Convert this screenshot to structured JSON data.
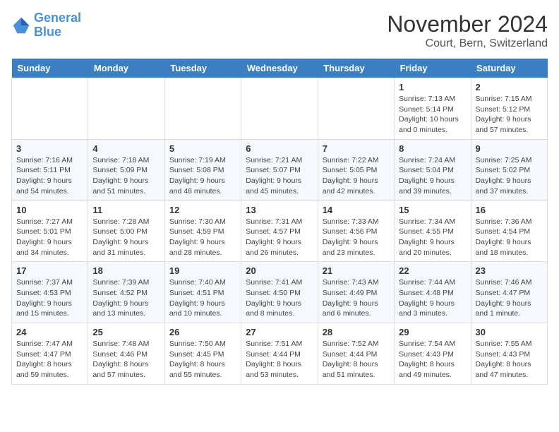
{
  "logo": {
    "line1": "General",
    "line2": "Blue"
  },
  "title": "November 2024",
  "location": "Court, Bern, Switzerland",
  "days_of_week": [
    "Sunday",
    "Monday",
    "Tuesday",
    "Wednesday",
    "Thursday",
    "Friday",
    "Saturday"
  ],
  "weeks": [
    [
      {
        "day": "",
        "info": ""
      },
      {
        "day": "",
        "info": ""
      },
      {
        "day": "",
        "info": ""
      },
      {
        "day": "",
        "info": ""
      },
      {
        "day": "",
        "info": ""
      },
      {
        "day": "1",
        "info": "Sunrise: 7:13 AM\nSunset: 5:14 PM\nDaylight: 10 hours\nand 0 minutes."
      },
      {
        "day": "2",
        "info": "Sunrise: 7:15 AM\nSunset: 5:12 PM\nDaylight: 9 hours\nand 57 minutes."
      }
    ],
    [
      {
        "day": "3",
        "info": "Sunrise: 7:16 AM\nSunset: 5:11 PM\nDaylight: 9 hours\nand 54 minutes."
      },
      {
        "day": "4",
        "info": "Sunrise: 7:18 AM\nSunset: 5:09 PM\nDaylight: 9 hours\nand 51 minutes."
      },
      {
        "day": "5",
        "info": "Sunrise: 7:19 AM\nSunset: 5:08 PM\nDaylight: 9 hours\nand 48 minutes."
      },
      {
        "day": "6",
        "info": "Sunrise: 7:21 AM\nSunset: 5:07 PM\nDaylight: 9 hours\nand 45 minutes."
      },
      {
        "day": "7",
        "info": "Sunrise: 7:22 AM\nSunset: 5:05 PM\nDaylight: 9 hours\nand 42 minutes."
      },
      {
        "day": "8",
        "info": "Sunrise: 7:24 AM\nSunset: 5:04 PM\nDaylight: 9 hours\nand 39 minutes."
      },
      {
        "day": "9",
        "info": "Sunrise: 7:25 AM\nSunset: 5:02 PM\nDaylight: 9 hours\nand 37 minutes."
      }
    ],
    [
      {
        "day": "10",
        "info": "Sunrise: 7:27 AM\nSunset: 5:01 PM\nDaylight: 9 hours\nand 34 minutes."
      },
      {
        "day": "11",
        "info": "Sunrise: 7:28 AM\nSunset: 5:00 PM\nDaylight: 9 hours\nand 31 minutes."
      },
      {
        "day": "12",
        "info": "Sunrise: 7:30 AM\nSunset: 4:59 PM\nDaylight: 9 hours\nand 28 minutes."
      },
      {
        "day": "13",
        "info": "Sunrise: 7:31 AM\nSunset: 4:57 PM\nDaylight: 9 hours\nand 26 minutes."
      },
      {
        "day": "14",
        "info": "Sunrise: 7:33 AM\nSunset: 4:56 PM\nDaylight: 9 hours\nand 23 minutes."
      },
      {
        "day": "15",
        "info": "Sunrise: 7:34 AM\nSunset: 4:55 PM\nDaylight: 9 hours\nand 20 minutes."
      },
      {
        "day": "16",
        "info": "Sunrise: 7:36 AM\nSunset: 4:54 PM\nDaylight: 9 hours\nand 18 minutes."
      }
    ],
    [
      {
        "day": "17",
        "info": "Sunrise: 7:37 AM\nSunset: 4:53 PM\nDaylight: 9 hours\nand 15 minutes."
      },
      {
        "day": "18",
        "info": "Sunrise: 7:39 AM\nSunset: 4:52 PM\nDaylight: 9 hours\nand 13 minutes."
      },
      {
        "day": "19",
        "info": "Sunrise: 7:40 AM\nSunset: 4:51 PM\nDaylight: 9 hours\nand 10 minutes."
      },
      {
        "day": "20",
        "info": "Sunrise: 7:41 AM\nSunset: 4:50 PM\nDaylight: 9 hours\nand 8 minutes."
      },
      {
        "day": "21",
        "info": "Sunrise: 7:43 AM\nSunset: 4:49 PM\nDaylight: 9 hours\nand 6 minutes."
      },
      {
        "day": "22",
        "info": "Sunrise: 7:44 AM\nSunset: 4:48 PM\nDaylight: 9 hours\nand 3 minutes."
      },
      {
        "day": "23",
        "info": "Sunrise: 7:46 AM\nSunset: 4:47 PM\nDaylight: 9 hours\nand 1 minute."
      }
    ],
    [
      {
        "day": "24",
        "info": "Sunrise: 7:47 AM\nSunset: 4:47 PM\nDaylight: 8 hours\nand 59 minutes."
      },
      {
        "day": "25",
        "info": "Sunrise: 7:48 AM\nSunset: 4:46 PM\nDaylight: 8 hours\nand 57 minutes."
      },
      {
        "day": "26",
        "info": "Sunrise: 7:50 AM\nSunset: 4:45 PM\nDaylight: 8 hours\nand 55 minutes."
      },
      {
        "day": "27",
        "info": "Sunrise: 7:51 AM\nSunset: 4:44 PM\nDaylight: 8 hours\nand 53 minutes."
      },
      {
        "day": "28",
        "info": "Sunrise: 7:52 AM\nSunset: 4:44 PM\nDaylight: 8 hours\nand 51 minutes."
      },
      {
        "day": "29",
        "info": "Sunrise: 7:54 AM\nSunset: 4:43 PM\nDaylight: 8 hours\nand 49 minutes."
      },
      {
        "day": "30",
        "info": "Sunrise: 7:55 AM\nSunset: 4:43 PM\nDaylight: 8 hours\nand 47 minutes."
      }
    ]
  ]
}
